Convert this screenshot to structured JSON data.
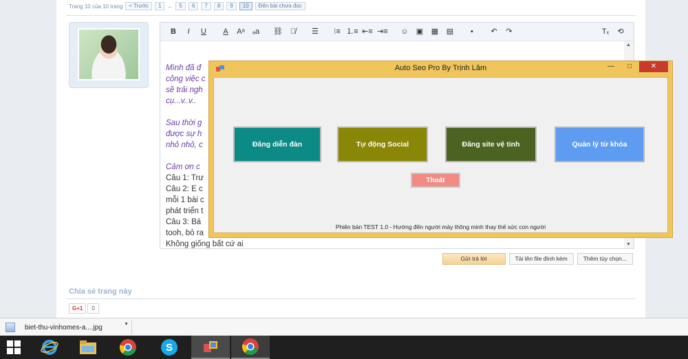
{
  "forum": {
    "pager": {
      "label": "Trang 10 của 10 trang",
      "prev": "< Trước",
      "pages": [
        "1",
        "←",
        "5",
        "6",
        "7",
        "8",
        "9",
        "10"
      ],
      "current": "10",
      "unread": "Đến bài chưa đọc"
    },
    "editor": {
      "lines": [
        {
          "text": "Mình đã đ",
          "style": "it"
        },
        {
          "text": "công việc c",
          "style": "it"
        },
        {
          "text": "sẽ trải ngh",
          "style": "it"
        },
        {
          "text": "cụ...v..v..",
          "style": "it"
        },
        {
          "text": "",
          "style": "gap"
        },
        {
          "text": "Sau thời g",
          "style": "it"
        },
        {
          "text": "được sự h",
          "style": "it"
        },
        {
          "text": "nhỏ nhỏ, c",
          "style": "it"
        },
        {
          "text": "",
          "style": "gap"
        },
        {
          "text": "Cảm ơn c",
          "style": "it"
        },
        {
          "text": "Câu 1: Trư",
          "style": "n"
        },
        {
          "text": "Câu 2: E c",
          "style": "n"
        },
        {
          "text": "mỗi 1 bài c",
          "style": "n"
        },
        {
          "text": "phát triển t",
          "style": "n"
        },
        {
          "text": "Câu 3: Bá",
          "style": "n"
        },
        {
          "text": "tooh, bỏ ra",
          "style": "n"
        },
        {
          "text": "Không giống bất cứ ai",
          "style": "n"
        }
      ]
    },
    "actions": {
      "reply": "Gửi trả lời",
      "upload": "Tải lên file đính kèm",
      "more": "Thêm tùy chọn..."
    },
    "share": {
      "title": "Chia sẻ trang này",
      "gplus": "G+1",
      "count": "0"
    }
  },
  "app": {
    "title": "Auto Seo Pro By Trịnh Lâm",
    "buttons": [
      {
        "label": "Đăng diễn đàn",
        "color": "#0b8a86"
      },
      {
        "label": "Tự động Social",
        "color": "#8a8606"
      },
      {
        "label": "Đăng site vệ tinh",
        "color": "#4c6221"
      },
      {
        "label": "Quản lý từ khóa",
        "color": "#5e9cf1"
      }
    ],
    "exit": "Thoát",
    "version": "Phiên bản TEST 1.0 - Hướng đến người máy thông minh thay thế sức con người",
    "window_controls": {
      "minimize": "—",
      "maximize": "□",
      "close": "✕"
    }
  },
  "download": {
    "filename": "biet-thu-vinhomes-a....jpg"
  },
  "taskbar": {
    "items": [
      "windows-start-icon",
      "internet-explorer-icon",
      "file-explorer-icon",
      "chrome-icon",
      "skype-icon",
      "auto-seo-app-icon",
      "chrome-icon"
    ]
  }
}
